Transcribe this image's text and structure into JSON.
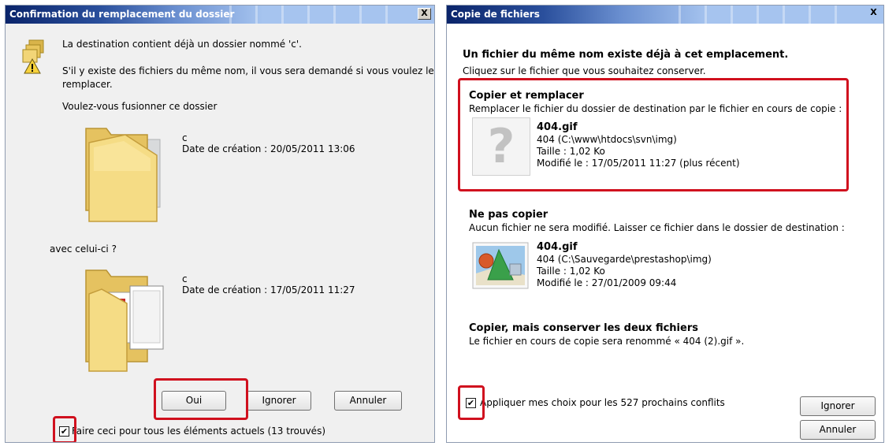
{
  "colors": {
    "highlight": "#d0101e",
    "title_bar": "#0a246a",
    "folder": "#f2d577"
  },
  "dialog_merge": {
    "title": "Confirmation du remplacement du dossier",
    "close_label": "X",
    "line1": "La destination contient déjà un dossier nommé 'c'.",
    "line2a": "S'il y existe des fichiers du même nom, il vous sera demandé si vous voulez les",
    "line2b": "remplacer.",
    "question": "Voulez-vous fusionner ce dossier",
    "existing": {
      "name": "c",
      "date": "Date de création : 20/05/2011 13:06"
    },
    "with_label": "avec celui-ci ?",
    "incoming": {
      "name": "c",
      "date": "Date de création : 17/05/2011 11:27"
    },
    "btn_yes": "Oui",
    "btn_skip": "Ignorer",
    "btn_cancel": "Annuler",
    "checkbox_label": "Faire ceci pour tous les éléments actuels (13 trouvés)",
    "checkbox_mark": "✔"
  },
  "dialog_copy": {
    "title": "Copie de fichiers",
    "close_label": "X",
    "heading": "Un fichier du même nom existe déjà à cet emplacement.",
    "subheading": "Cliquez sur le fichier que vous souhaitez conserver.",
    "option_replace": {
      "title": "Copier et remplacer",
      "desc": "Remplacer le fichier du dossier de destination par le fichier en cours de copie :",
      "file_name": "404.gif",
      "path": "404 (C:\\www\\htdocs\\svn\\img)",
      "size": "Taille : 1,02 Ko",
      "modified": "Modifié le : 17/05/2011 11:27 (plus récent)"
    },
    "option_keep": {
      "title": "Ne pas copier",
      "desc": "Aucun fichier ne sera modifié. Laisser ce fichier dans le dossier de destination :",
      "file_name": "404.gif",
      "path": "404 (C:\\Sauvegarde\\prestashop\\img)",
      "size": "Taille : 1,02 Ko",
      "modified": "Modifié le : 27/01/2009 09:44"
    },
    "option_both": {
      "title": "Copier, mais conserver les deux fichiers",
      "desc": "Le fichier en cours de copie sera renommé « 404 (2).gif »."
    },
    "checkbox_label": "Appliquer mes choix pour les 527 prochains conflits",
    "checkbox_mark": "✔",
    "btn_skip": "Ignorer",
    "btn_cancel": "Annuler",
    "question_glyph": "?"
  }
}
